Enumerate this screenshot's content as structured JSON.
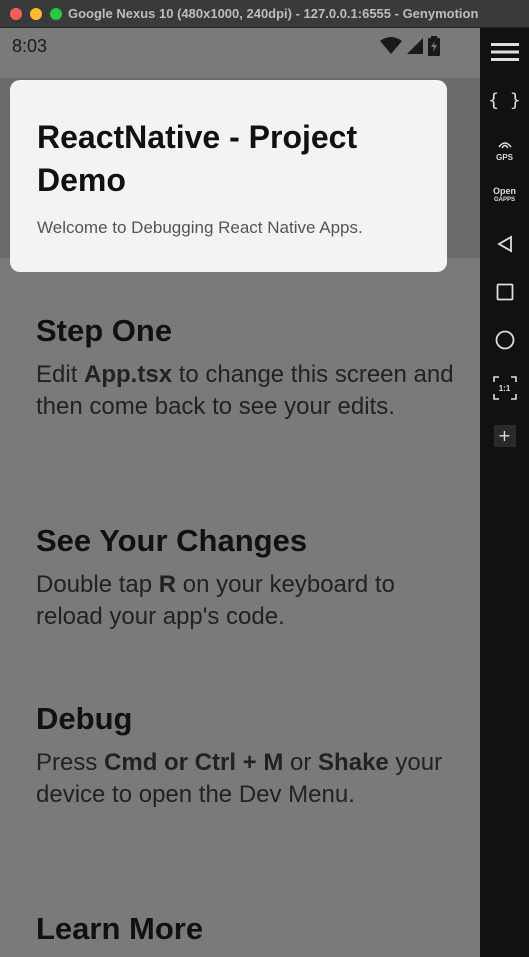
{
  "window": {
    "title": "Google Nexus 10 (480x1000, 240dpi) - 127.0.0.1:6555 - Genymotion"
  },
  "status_bar": {
    "time": "8:03"
  },
  "header": {
    "title": "ReactNative - Project Demo",
    "subtitle": "Welcome to Debugging React Native Apps."
  },
  "sections": [
    {
      "title": "Step One",
      "body": [
        {
          "text": "Edit ",
          "bold": false
        },
        {
          "text": "App.tsx",
          "bold": true
        },
        {
          "text": " to change this screen and then come back to see your edits.",
          "bold": false
        }
      ]
    },
    {
      "title": "See Your Changes",
      "body": [
        {
          "text": "Double tap ",
          "bold": false
        },
        {
          "text": "R",
          "bold": true
        },
        {
          "text": " on your keyboard to reload your app's code.",
          "bold": false
        }
      ]
    },
    {
      "title": "Debug",
      "body": [
        {
          "text": "Press ",
          "bold": false
        },
        {
          "text": "Cmd or Ctrl + M",
          "bold": true
        },
        {
          "text": " or ",
          "bold": false
        },
        {
          "text": "Shake",
          "bold": true
        },
        {
          "text": " your device to open the Dev Menu.",
          "bold": false
        }
      ]
    },
    {
      "title": "Learn More",
      "body": []
    }
  ],
  "toolbar": {
    "gps_label": "GPS",
    "open_gapps_label": "Open",
    "gapps_label": "GAPPS",
    "scale_label": "1:1"
  }
}
